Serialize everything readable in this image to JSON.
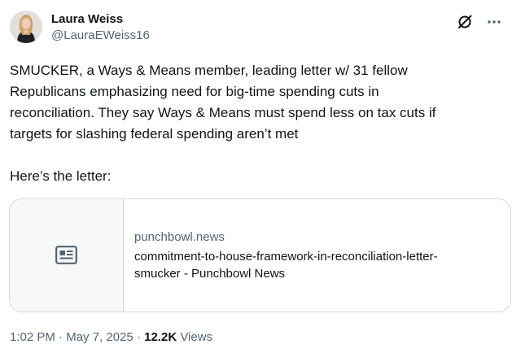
{
  "author": {
    "display_name": "Laura Weiss",
    "handle": "@LauraEWeiss16"
  },
  "header": {
    "icons": [
      "grok-icon",
      "more-icon"
    ]
  },
  "tweet": {
    "text": "SMUCKER, a Ways & Means member, leading letter w/ 31 fellow\nRepublicans emphasizing need for big-time spending cuts in\nreconciliation. They say Ways & Means must spend less on tax cuts if\ntargets for slashing federal spending aren’t met\n\nHere’s the letter:"
  },
  "card": {
    "domain": "punchbowl.news",
    "title": "commitment-to-house-framework-in-reconciliation-letter-\nsmucker - Punchbowl News",
    "icon": "article-icon"
  },
  "meta": {
    "time": "1:02 PM",
    "sep1": " · ",
    "date": "May 7, 2025",
    "sep2": " · ",
    "views_count": "12.2K",
    "views_label": " Views"
  }
}
